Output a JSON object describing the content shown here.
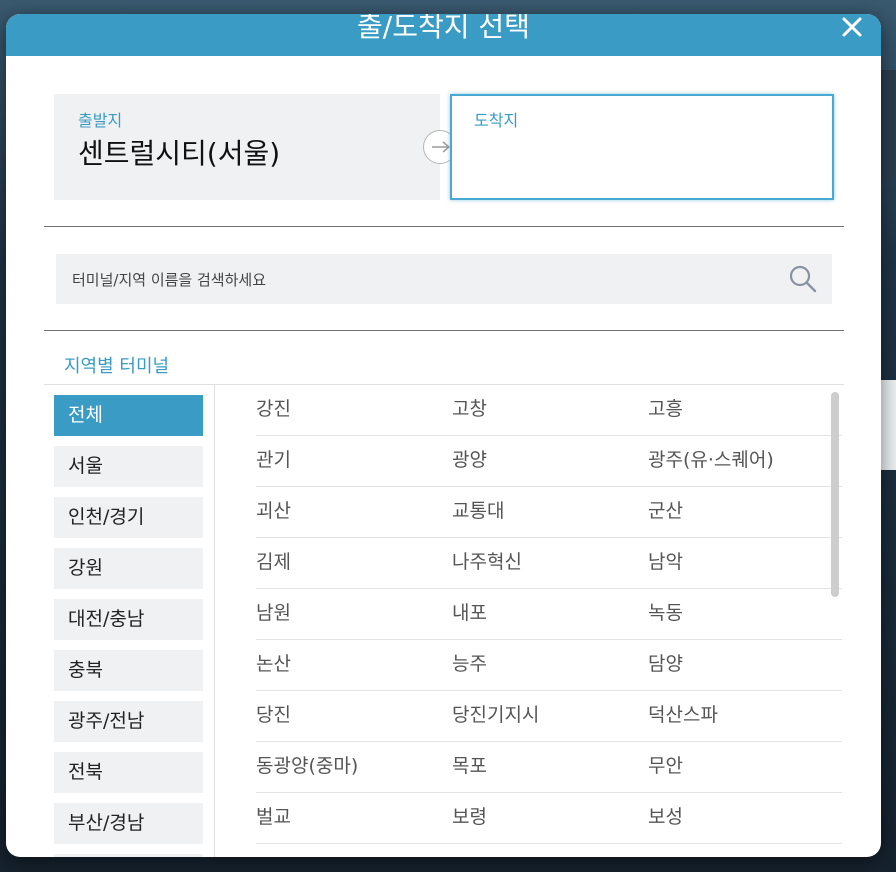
{
  "modal": {
    "title": "출/도착지 선택"
  },
  "route": {
    "origin_label": "출발지",
    "origin_value": "센트럴시티(서울)",
    "destination_label": "도착지",
    "destination_value": ""
  },
  "search": {
    "placeholder": "터미널/지역 이름을 검색하세요"
  },
  "regions": {
    "title": "지역별 터미널",
    "items": [
      "전체",
      "서울",
      "인천/경기",
      "강원",
      "대전/충남",
      "충북",
      "광주/전남",
      "전북",
      "부산/경남"
    ],
    "selected": "전체"
  },
  "terminals": [
    [
      "강진",
      "고창",
      "고흥"
    ],
    [
      "관기",
      "광양",
      "광주(유·스퀘어)"
    ],
    [
      "괴산",
      "교통대",
      "군산"
    ],
    [
      "김제",
      "나주혁신",
      "남악"
    ],
    [
      "남원",
      "내포",
      "녹동"
    ],
    [
      "논산",
      "능주",
      "담양"
    ],
    [
      "당진",
      "당진기지시",
      "덕산스파"
    ],
    [
      "동광양(중마)",
      "목포",
      "무안"
    ],
    [
      "벌교",
      "보령",
      "보성"
    ]
  ],
  "colors": {
    "accent": "#3a9cc4",
    "panel": "#f0f1f2"
  }
}
